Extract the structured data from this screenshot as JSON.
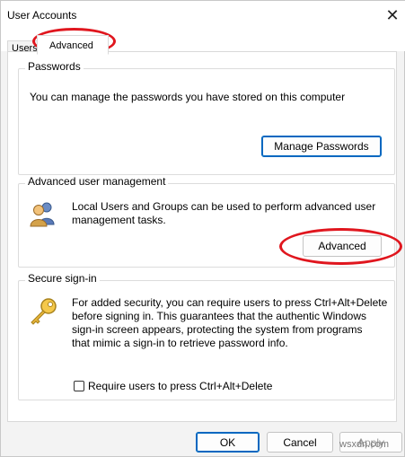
{
  "window": {
    "title": "User Accounts",
    "close_glyph": "✕"
  },
  "tabs": [
    {
      "label": "Users"
    },
    {
      "label": "Advanced"
    }
  ],
  "passwords": {
    "legend": "Passwords",
    "description": "You can manage the passwords you have stored on this computer",
    "button": "Manage Passwords"
  },
  "advanced_user_management": {
    "legend": "Advanced user management",
    "description_line1": "Local Users and Groups can be used to perform advanced user",
    "description_line2": "management tasks.",
    "button": "Advanced",
    "icon": "users-icon"
  },
  "secure_sign_in": {
    "legend": "Secure sign-in",
    "description_line1": "For added security, you can require users to press Ctrl+Alt+Delete",
    "description_line2": "before signing in. This guarantees that the authentic Windows",
    "description_line3": "sign-in screen appears, protecting the system from programs",
    "description_line4": "that mimic a sign-in to retrieve password info.",
    "checkbox_label": "Require users to press Ctrl+Alt+Delete",
    "checkbox_checked": false,
    "icon": "key-icon"
  },
  "footer": {
    "ok": "OK",
    "cancel": "Cancel",
    "apply": "Apply"
  },
  "colors": {
    "annotation": "#e0161e",
    "primary_border": "#0067c0"
  },
  "watermark": "wsxdn.com"
}
